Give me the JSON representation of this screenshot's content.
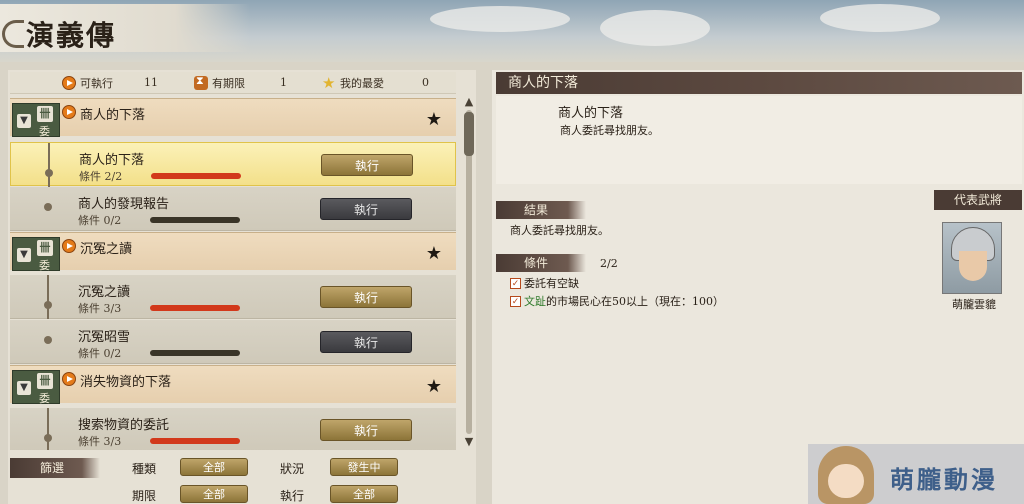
{
  "title": "演義傳",
  "summary": {
    "executable_label": "可執行",
    "executable_count": "11",
    "limited_label": "有期限",
    "limited_count": "1",
    "favorite_label": "我的最愛",
    "favorite_count": "0"
  },
  "exec_label": "執行",
  "categories": [
    {
      "name": "商人的下落",
      "type": "委託",
      "scroll_icon": "卌",
      "fav": "★"
    },
    {
      "name": "沉冤之讀",
      "type": "委託",
      "scroll_icon": "卌",
      "fav": "★"
    },
    {
      "name": "消失物資的下落",
      "type": "委託",
      "scroll_icon": "卌",
      "fav": "★"
    }
  ],
  "quests": [
    {
      "name": "商人的下落",
      "cond": "條件 2/2",
      "progress": 1.0,
      "active": true
    },
    {
      "name": "商人的發現報告",
      "cond": "條件 0/2",
      "progress": 0.0,
      "active": false
    },
    {
      "name": "沉冤之讀",
      "cond": "條件 3/3",
      "progress": 1.0,
      "active": true
    },
    {
      "name": "沉冤昭雪",
      "cond": "條件 0/2",
      "progress": 0.0,
      "active": false
    },
    {
      "name": "搜索物資的委託",
      "cond": "條件 3/3",
      "progress": 1.0,
      "active": true
    }
  ],
  "filter": {
    "tag": "篩選",
    "type_label": "種類",
    "type_value": "全部",
    "status_label": "狀況",
    "status_value": "發生中",
    "period_label": "期限",
    "period_value": "全部",
    "exec_label": "執行",
    "exec_value": "全部"
  },
  "detail": {
    "title": "商人的下落",
    "subtitle": "商人的下落",
    "description": "商人委託尋找朋友。",
    "result_tag": "結果",
    "result_text": "商人委託尋找朋友。",
    "cond_tag": "條件",
    "cond_count": "2/2",
    "cond1": "委託有空缺",
    "cond2_hl": "文趾",
    "cond2_rest": "的市場民心在50以上（現在：100）"
  },
  "representative": {
    "tag": "代表武將",
    "name": "萌朧雲貔"
  },
  "watermark": "萌朧動漫"
}
